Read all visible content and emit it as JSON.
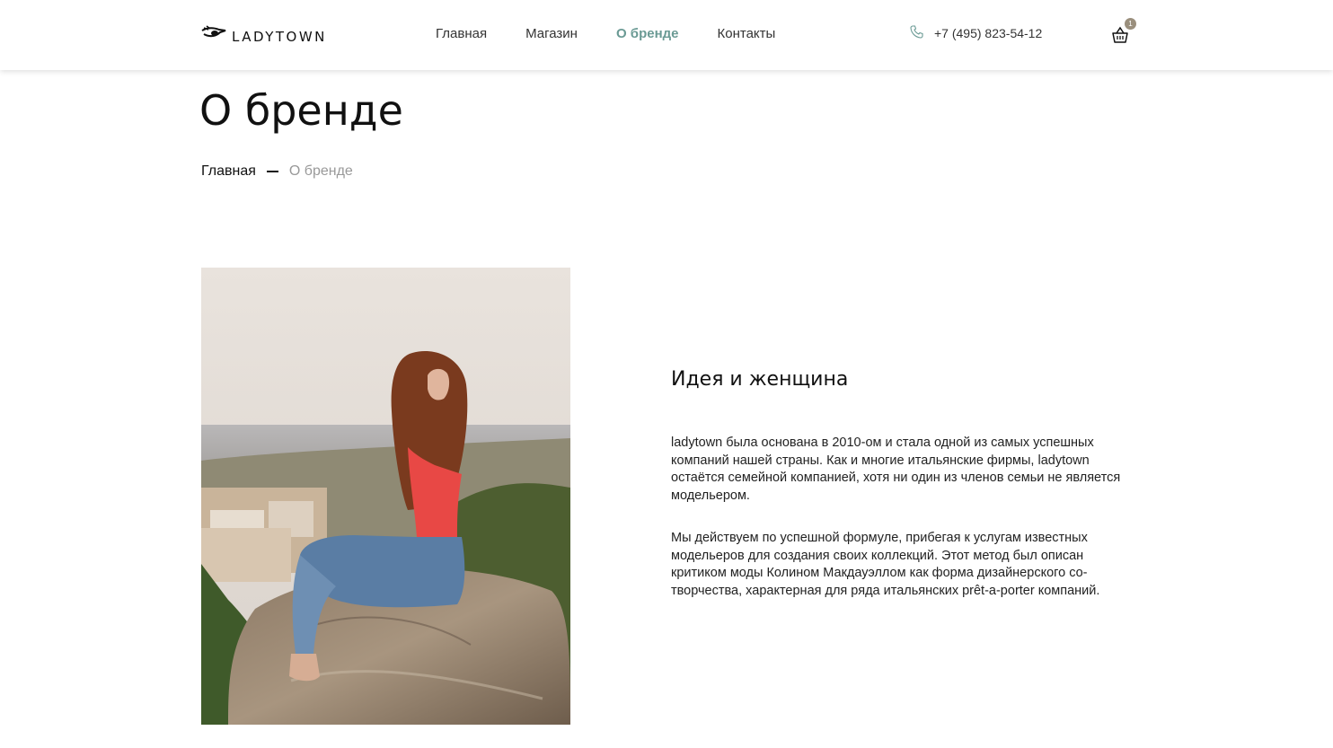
{
  "header": {
    "logo_text": "LADYTOWN",
    "nav": [
      {
        "label": "Главная",
        "active": false
      },
      {
        "label": "Магазин",
        "active": false
      },
      {
        "label": "О бренде",
        "active": true
      },
      {
        "label": "Контакты",
        "active": false
      }
    ],
    "phone": "+7 (495) 823-54-12",
    "cart_count": "1"
  },
  "page": {
    "title": "О бренде",
    "breadcrumb": {
      "home": "Главная",
      "current": "О бренде"
    }
  },
  "content": {
    "section_title": "Идея и женщина",
    "paragraphs": [
      "ladytown была основана в 2010-ом и стала одной из самых успешных компаний нашей страны. Как и многие итальянские фирмы, ladytown остаётся семейной компанией, хотя ни один из членов семьи не является модельером.",
      "Мы действуем по успешной формуле, прибегая к услугам известных модельеров для создания своих коллекций. Этот метод был описан критиком моды Колином Макдауэллом как форма дизайнерского со-творчества, характерная для ряда итальянских prêt-a-porter компаний."
    ]
  },
  "colors": {
    "accent": "#6a9a94",
    "badge": "#9a8f7d",
    "muted": "#999999"
  },
  "icons": {
    "logo": "eye-logo-icon",
    "phone": "phone-icon",
    "cart": "shopping-basket-icon"
  }
}
